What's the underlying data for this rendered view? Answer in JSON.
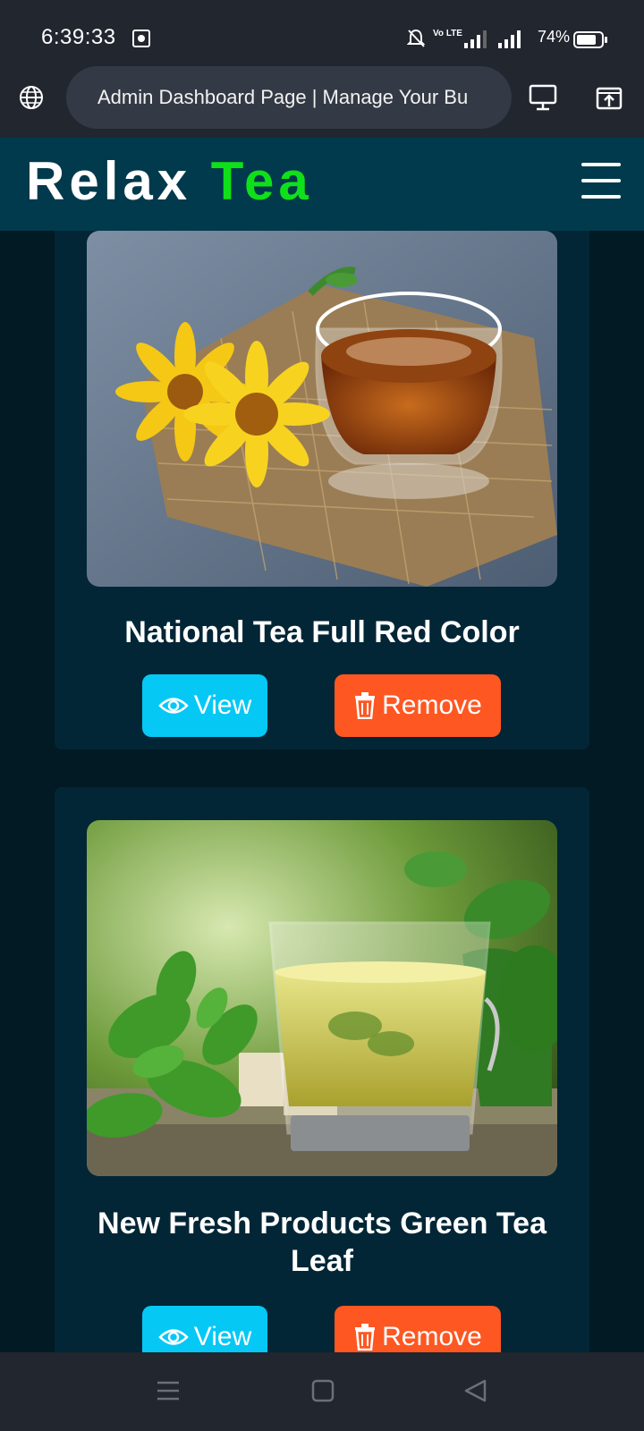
{
  "status_bar": {
    "time": "6:39:33",
    "battery": "74%",
    "icons": [
      "screenshot-icon",
      "bell-off-icon",
      "volte-icon",
      "signal-icon",
      "signal-icon",
      "battery-icon"
    ],
    "volte_label": "Vo LTE"
  },
  "browser": {
    "page_title": "Admin Dashboard Page | Manage Your Bu",
    "icons": [
      "globe-icon",
      "desktop-icon",
      "share-icon"
    ]
  },
  "header": {
    "brand_word1": "Relax",
    "brand_word2": "Tea",
    "brand_colors": {
      "word1": "#ffffff",
      "word2": "#10e019"
    },
    "menu_icon": "hamburger-icon"
  },
  "products": [
    {
      "title": "National Tea Full Red Color",
      "image": "glass cup of red tea on burlap with yellow flowers",
      "view_label": "View",
      "remove_label": "Remove"
    },
    {
      "title": "New Fresh Products Green Tea Leaf",
      "image": "glass cup of green tea with fresh mint leaves",
      "view_label": "View",
      "remove_label": "Remove"
    }
  ],
  "colors": {
    "page_bg": "#011a24",
    "card_bg": "#022636",
    "header_bg": "#013a4c",
    "view_button": "#05c8f5",
    "remove_button": "#fe5721"
  },
  "nav_bar": {
    "icons": [
      "menu-icon",
      "home-square-icon",
      "back-triangle-icon"
    ]
  }
}
